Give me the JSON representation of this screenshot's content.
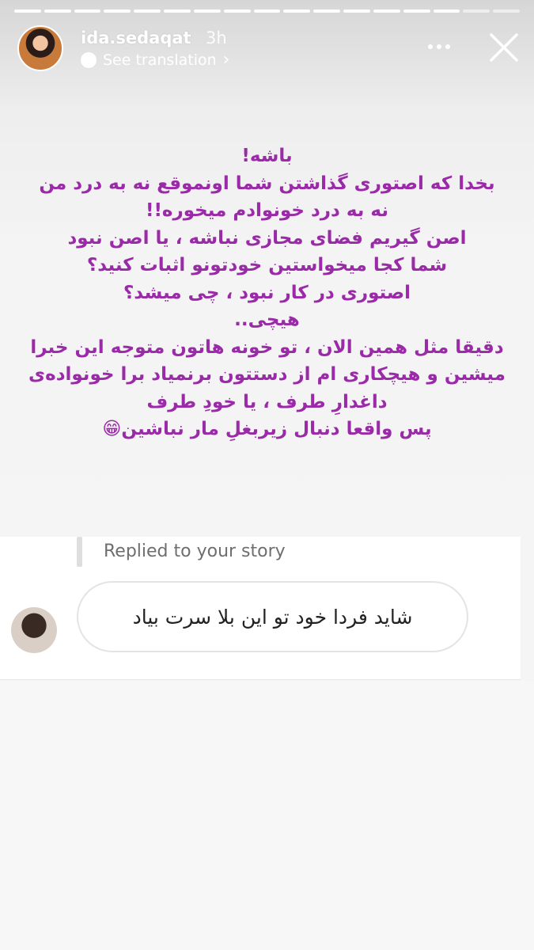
{
  "header": {
    "username": "ida.sedaqat",
    "time": "3h",
    "translation_label": "See translation"
  },
  "story": {
    "text_color": "#9a2aa8",
    "lines": [
      "باشه!",
      "بخدا که اصتوری گذاشتن شما اونموقع نه به درد من",
      "نه به درد خونوادم میخوره!!",
      "اصن گیریم فضای مجازی نباشه ، یا اصن نبود",
      "شما کجا میخواستین خودتونو اثبات کنید؟",
      "اصتوری در کار نبود ، چی میشد؟",
      "هیچی..",
      "دقیقا مثل همین الان ، تو خونه هاتون متوجه این خبرا",
      "میشین و هیچکاری ام از دستتون برنمیاد برا خونواده‌ی",
      "داغدارِ طرف ، یا خودِ طرف",
      "پس واقعا دنبال زیربغلِ مار نباشین😁"
    ]
  },
  "reply": {
    "label": "Replied to your story",
    "message": "شاید فردا خود تو این بلا سرت بیاد"
  }
}
